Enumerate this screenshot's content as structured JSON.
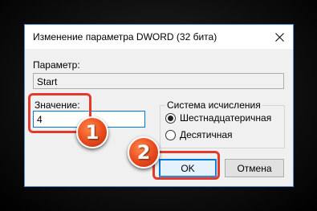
{
  "dialog": {
    "title": "Изменение параметра DWORD (32 бита)",
    "close_icon": "close-icon",
    "parameter_label": "Параметр:",
    "parameter_value": "Start",
    "value_label": "Значение:",
    "value_input": "4",
    "base_group_label": "Система исчисления",
    "radio_hex_label": "Шестнадцатеричная",
    "radio_dec_label": "Десятичная",
    "selected_base": "hex",
    "ok_label": "OK",
    "cancel_label": "Отмена"
  },
  "annotations": {
    "step1": "1",
    "step2": "2",
    "highlight_color": "#e33a2c",
    "badge_color": "#e8491d"
  }
}
